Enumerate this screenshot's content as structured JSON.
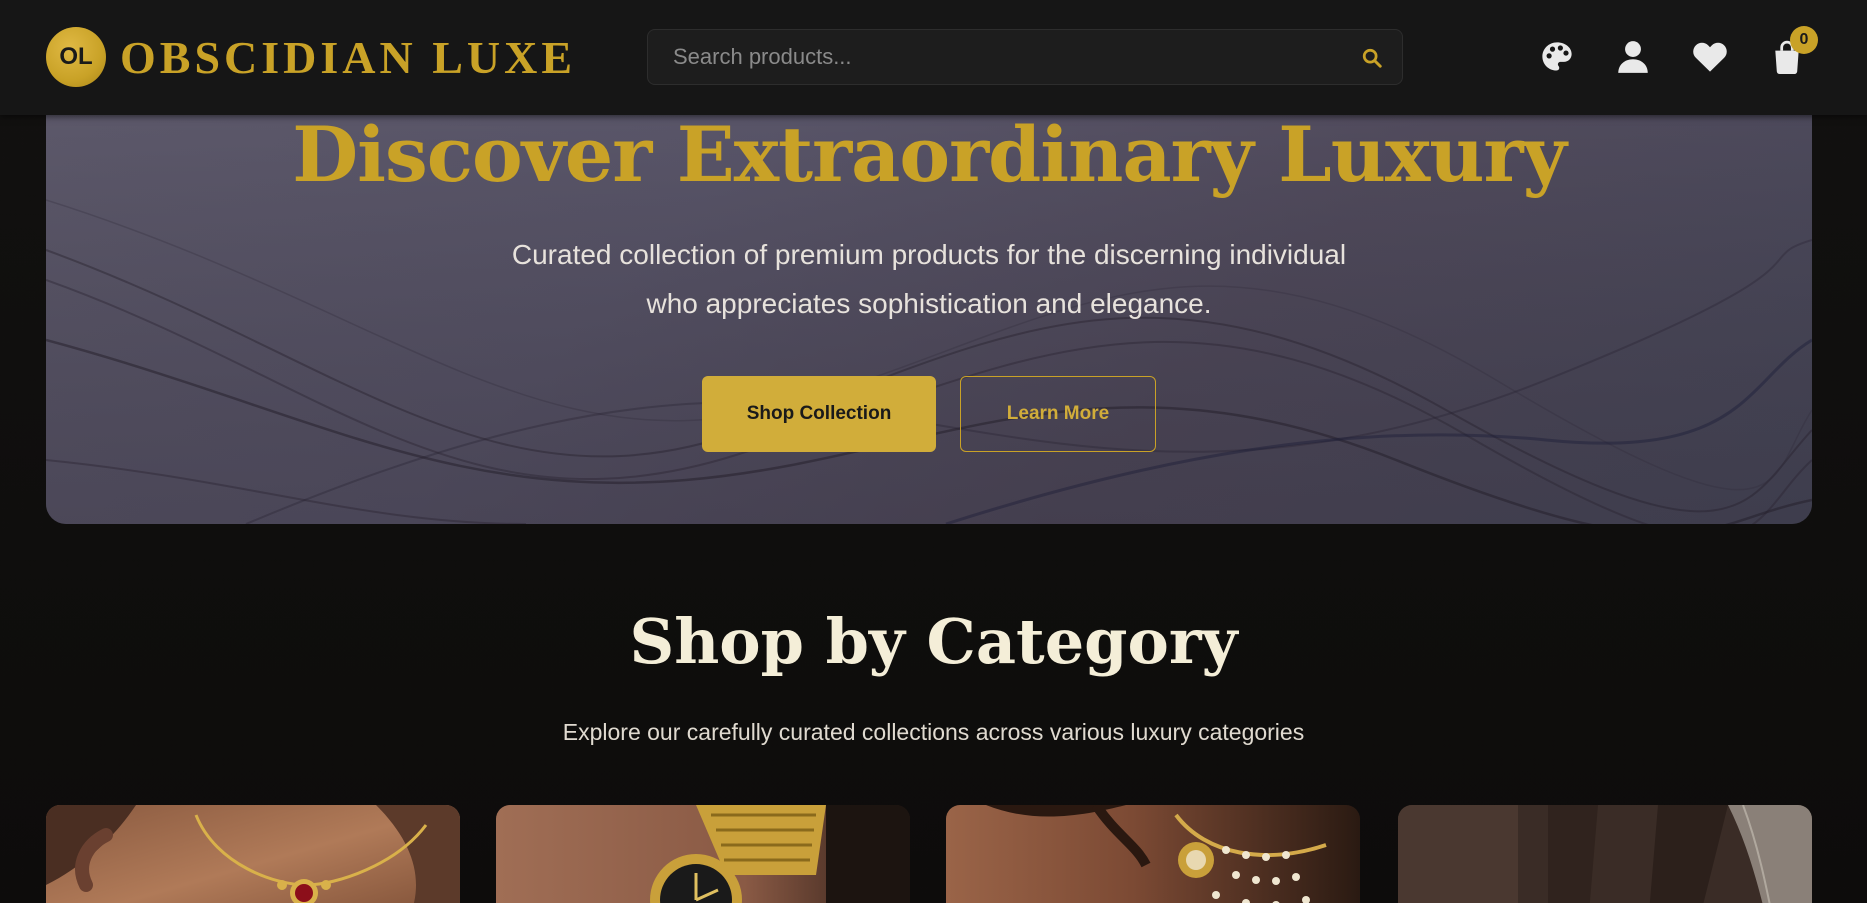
{
  "header": {
    "logo_initials": "OL",
    "brand_name": "OBSCIDIAN LUXE",
    "search_placeholder": "Search products...",
    "cart_count": "0",
    "icons": [
      "palette-icon",
      "user-icon",
      "heart-icon",
      "shopping-bag-icon",
      "search-icon"
    ]
  },
  "hero": {
    "title": "Discover Extraordinary Luxury",
    "subtitle_line1": "Curated collection of premium products for the discerning individual",
    "subtitle_line2": "who appreciates sophistication and elegance.",
    "primary_button": "Shop Collection",
    "secondary_button": "Learn More"
  },
  "categories": {
    "title": "Shop by Category",
    "subtitle": "Explore our carefully curated collections across various luxury categories"
  },
  "colors": {
    "accent_gold": "#c9a227",
    "background": "#121110",
    "header_bg": "#161616"
  }
}
